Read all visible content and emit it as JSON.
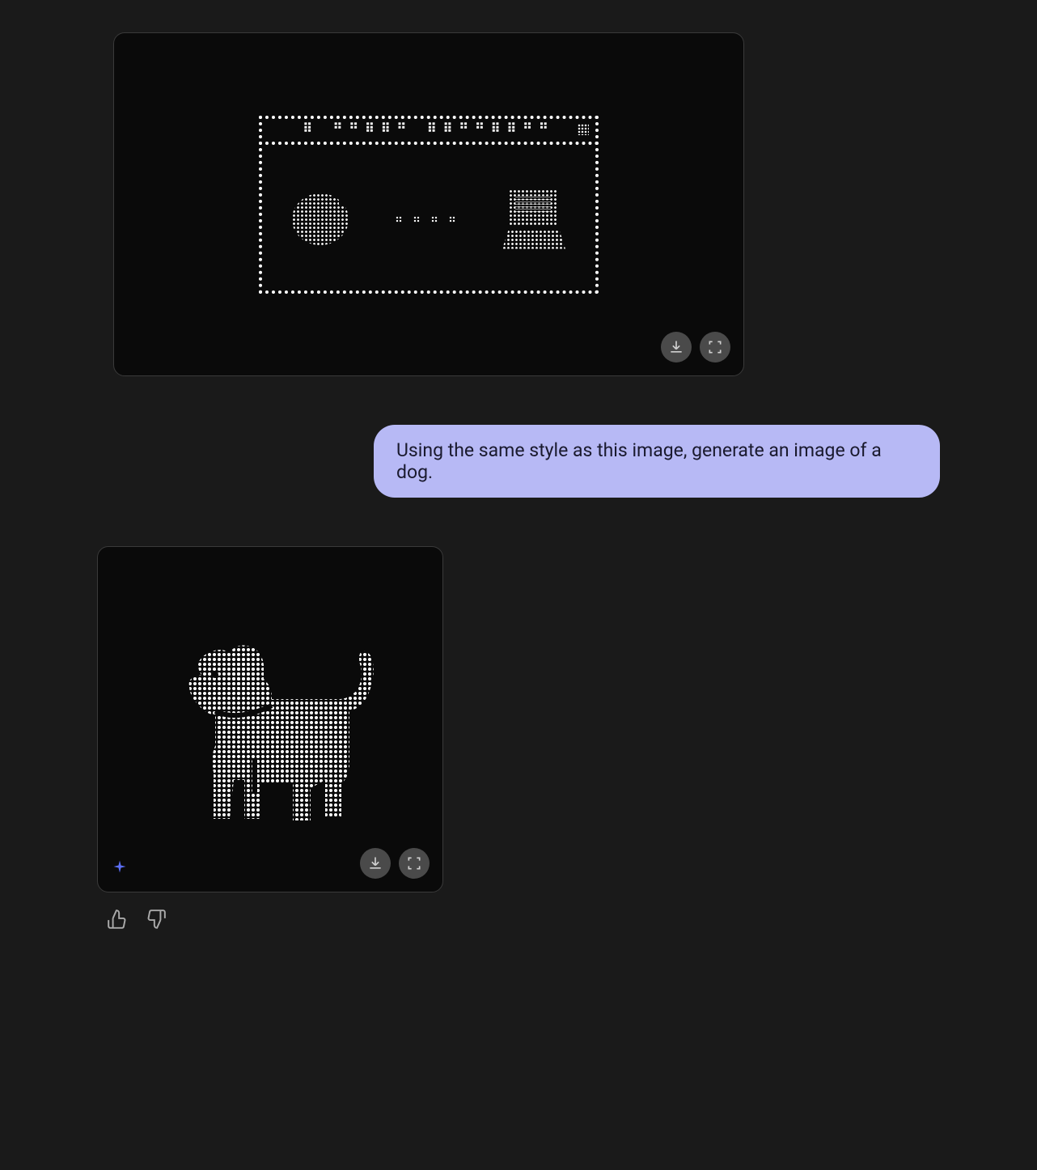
{
  "messages": {
    "user_prompt": "Using the same style as this image, generate an image of a dog."
  },
  "images": {
    "reference": {
      "description": "dotted-ascii-browser-window-globe-computer",
      "title_text": "⠿ ⠛⠛⠿⠿⠛ ⠿⠿⠛⠛⠿⠿⠛⠛"
    },
    "generated": {
      "description": "dotted-ascii-dog"
    }
  },
  "controls": {
    "download_label": "Download",
    "fullscreen_label": "Fullscreen",
    "thumbs_up_label": "Good response",
    "thumbs_down_label": "Bad response",
    "ai_badge_label": "AI generated"
  },
  "colors": {
    "background": "#1a1a1a",
    "card_background": "#0a0a0a",
    "border": "#3a3a3a",
    "user_bubble": "#b7b9f5",
    "user_text": "#1a1a2e",
    "icon_bg": "#4a4a4a",
    "sparkle": "#5b6ef5"
  }
}
